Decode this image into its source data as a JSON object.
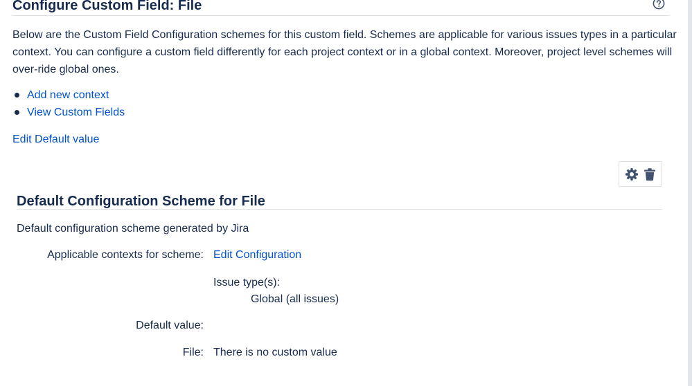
{
  "header": {
    "title": "Configure Custom Field: File",
    "help_icon": "question-circle-icon"
  },
  "description": "Below are the Custom Field Configuration schemes for this custom field. Schemes are applicable for various issues types in a particular context. You can configure a custom field differently for each project context or in a global context. Moreover, project level schemes will over-ride global ones.",
  "links": [
    {
      "label": "Add new context"
    },
    {
      "label": "View Custom Fields"
    }
  ],
  "edit_default_value": "Edit Default value",
  "toolbar": {
    "configure_icon": "gear-icon",
    "delete_icon": "trash-icon"
  },
  "scheme": {
    "title": "Default Configuration Scheme for File",
    "description": "Default configuration scheme generated by Jira",
    "contexts_label": "Applicable contexts for scheme:",
    "edit_configuration": "Edit Configuration",
    "issue_types_label": "Issue type(s):",
    "issue_types_value": "Global (all issues)",
    "default_value_label": "Default value:",
    "file_label": "File:",
    "file_value": "There is no custom value"
  },
  "colors": {
    "link": "#0052cc",
    "text": "#172b4d",
    "border": "#dfe1e6"
  }
}
